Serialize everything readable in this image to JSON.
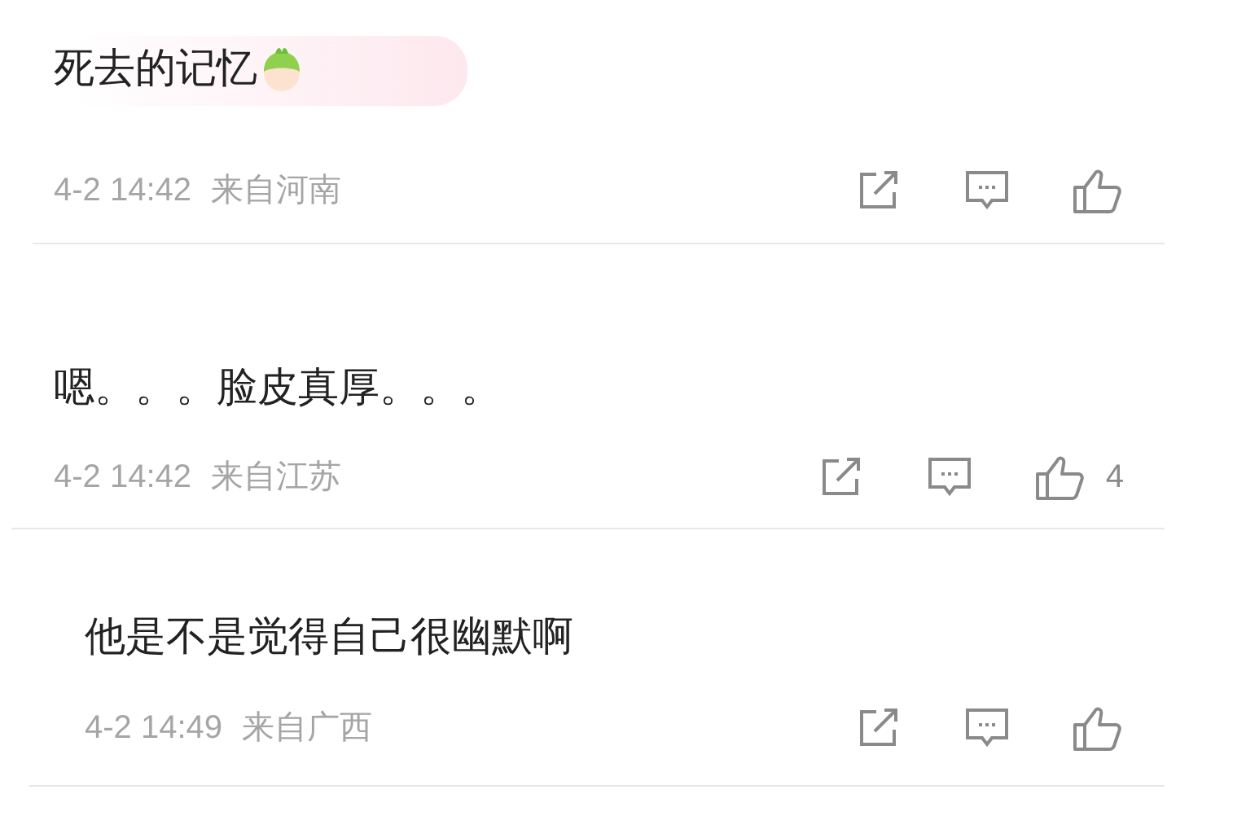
{
  "comments": [
    {
      "text": "死去的记忆",
      "sticker": true,
      "time": "4-2 14:42",
      "location": "来自河南"
    },
    {
      "text": "嗯。。。脸皮真厚。。。",
      "sticker": false,
      "time": "4-2 14:42",
      "location": "来自江苏",
      "like_count": "4"
    },
    {
      "text": "他是不是觉得自己很幽默啊",
      "sticker": false,
      "time": "4-2 14:49",
      "location": "来自广西"
    }
  ]
}
